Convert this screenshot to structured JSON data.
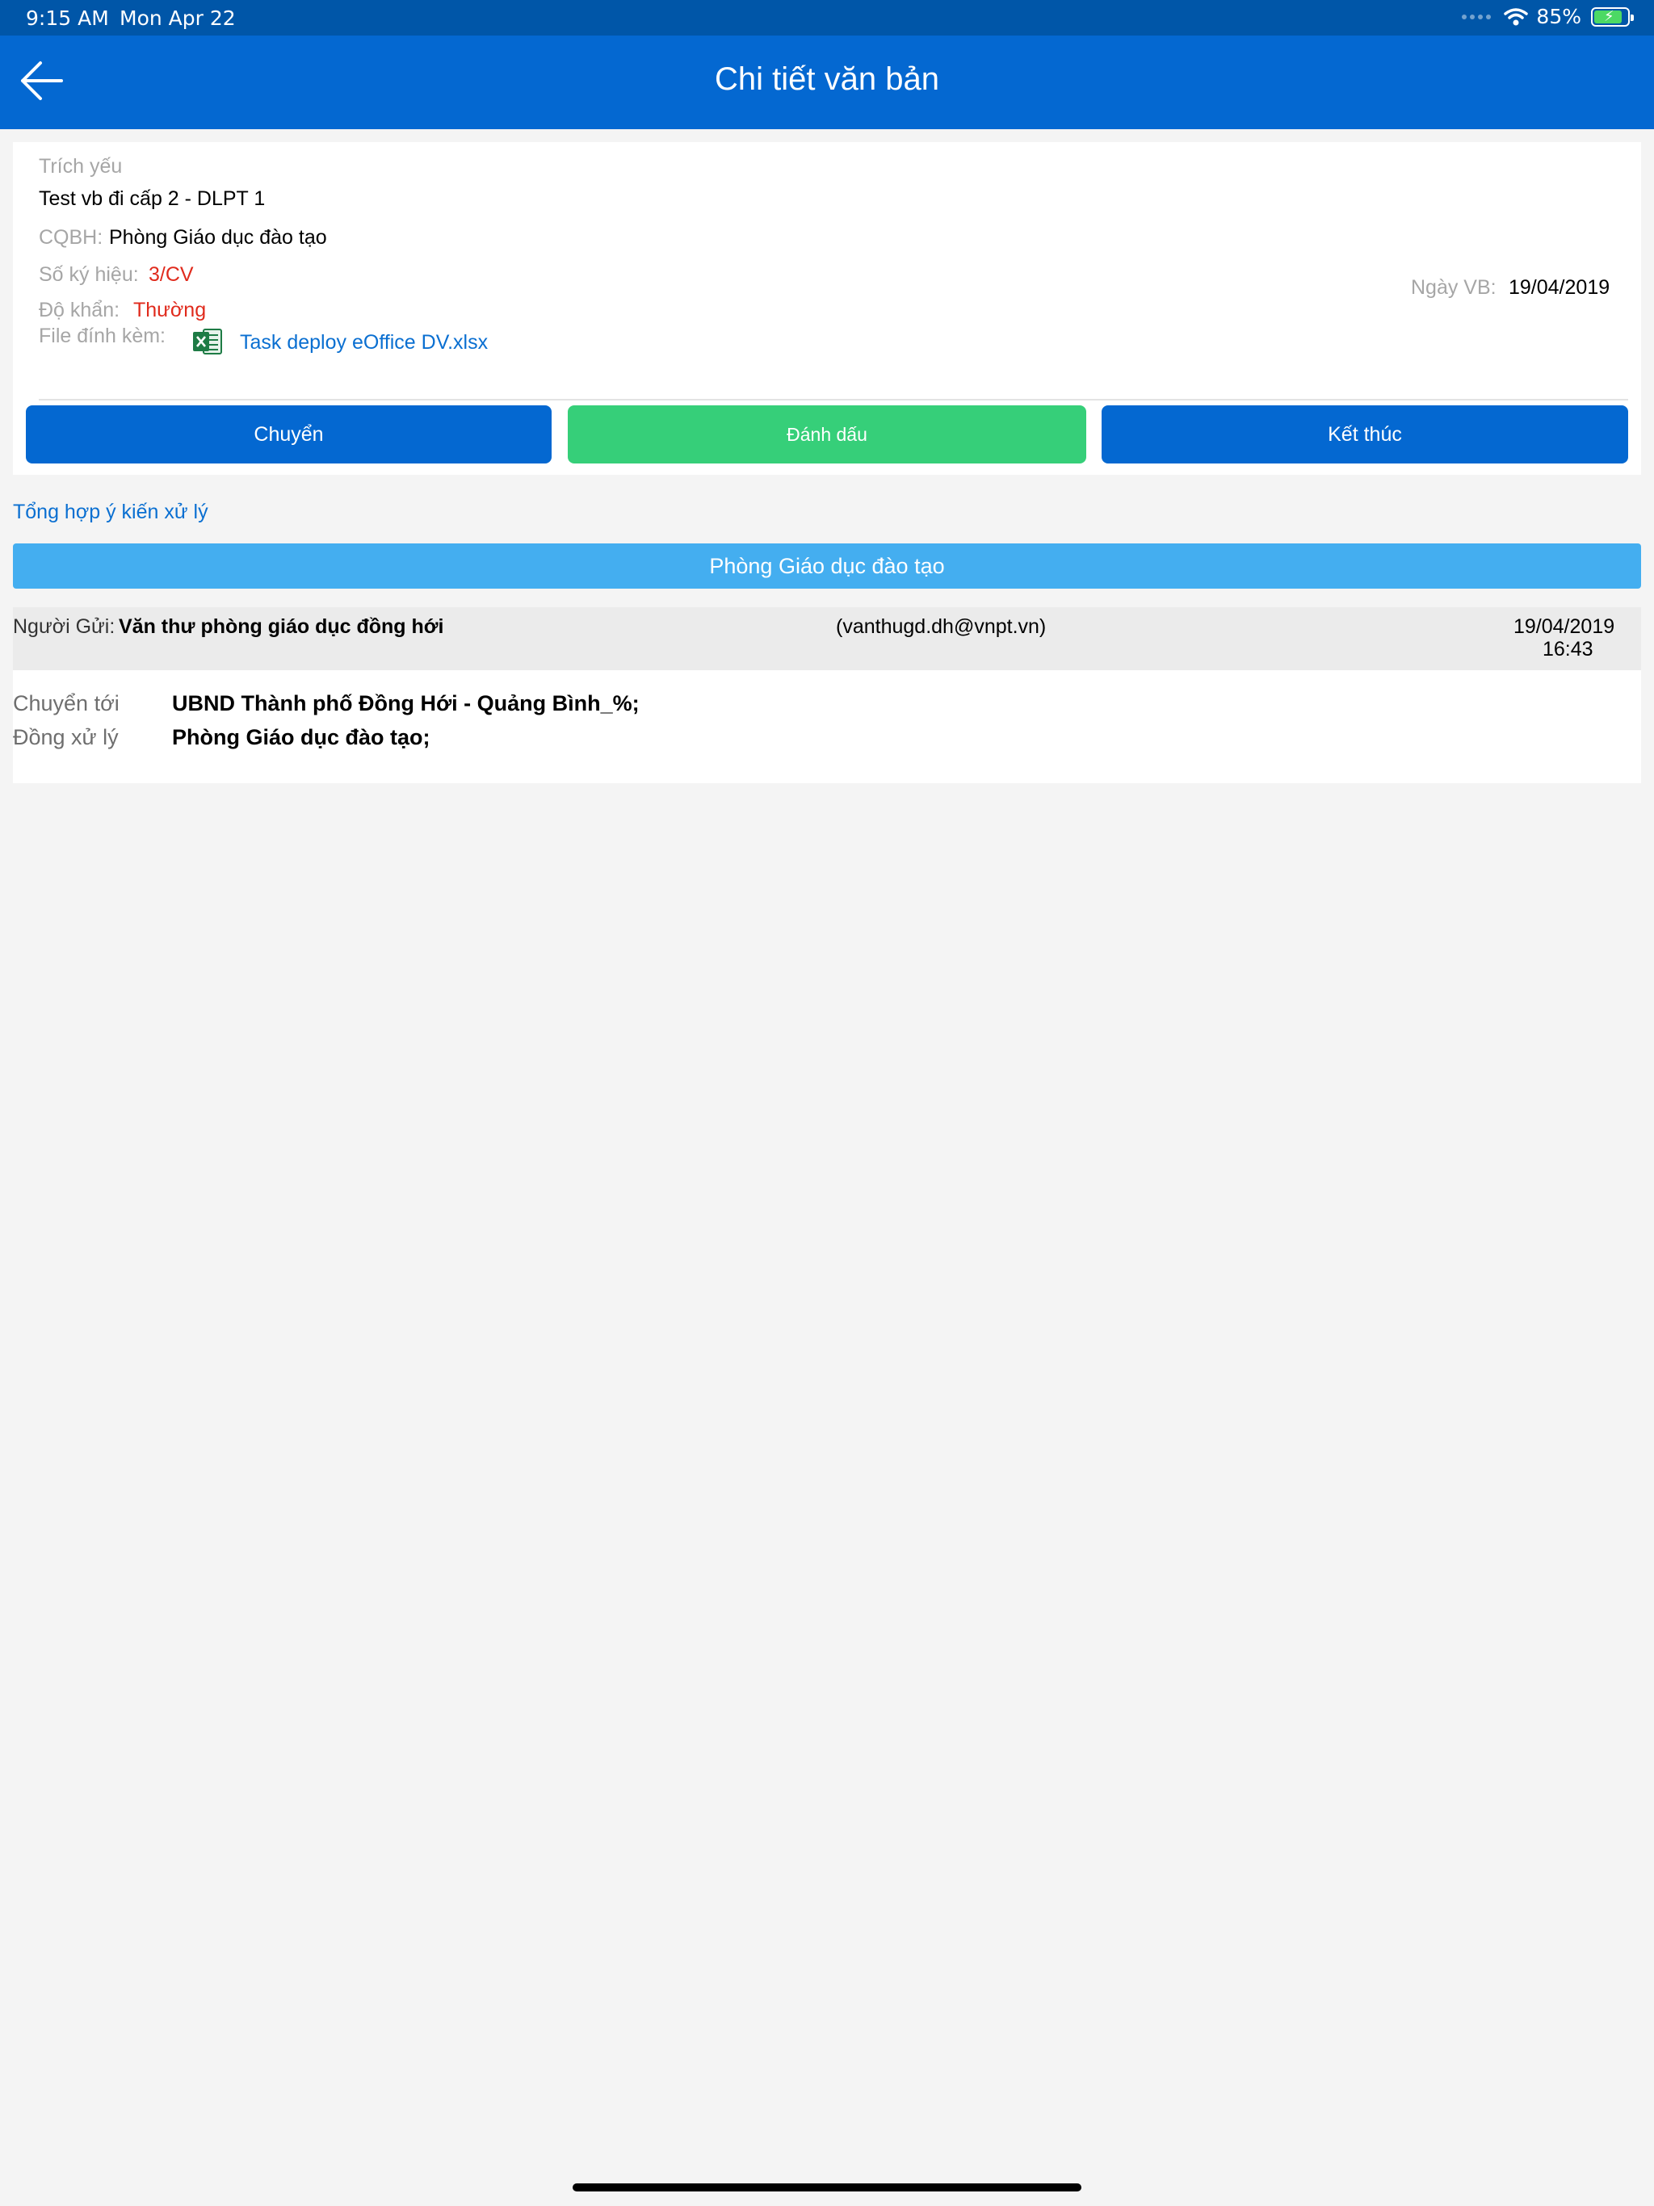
{
  "status_bar": {
    "time": "9:15 AM",
    "date": "Mon Apr 22",
    "battery": "85%",
    "icons": [
      "signal-dots-icon",
      "wifi-icon",
      "battery-charging-icon"
    ]
  },
  "nav": {
    "title": "Chi tiết văn bản",
    "back_icon": "arrow-left-icon"
  },
  "document": {
    "summary_label": "Trích yếu",
    "summary_value": "Test vb đi cấp 2 - DLPT 1",
    "issuer_label": "CQBH:",
    "issuer_value": "Phòng Giáo dục đào tạo",
    "number_label": "Số ký hiệu:",
    "number_value": "3/CV",
    "urgency_label": "Độ khẩn:",
    "urgency_value": "Thường",
    "attachment_label": "File đính kèm:",
    "attachment_name": "Task deploy eOffice DV.xlsx",
    "attachment_icon": "excel-file-icon",
    "date_label": "Ngày VB:",
    "date_value": "19/04/2019"
  },
  "actions": {
    "forward_label": "Chuyển",
    "mark_label": "Đánh dấu",
    "finish_label": "Kết thúc"
  },
  "opinions": {
    "summary_link": "Tổng hợp ý kiến xử lý",
    "section_title": "Phòng Giáo dục đào tạo",
    "sender_label": "Người Gửi:",
    "sender_name": "Văn thư phòng giáo dục đồng hới",
    "sender_email": "(vanthugd.dh@vnpt.vn)",
    "sent_date": "19/04/2019",
    "sent_time": "16:43",
    "forward_to_label": "Chuyển tới",
    "forward_to_value": "UBND Thành phố Đồng Hới - Quảng Bình_%;",
    "co_process_label": "Đồng xử lý",
    "co_process_value": "Phòng Giáo dục đào tạo;"
  },
  "colors": {
    "nav_blue": "#0468d1",
    "status_blue": "#0056a8",
    "green": "#36cf79",
    "light_blue": "#44aef0",
    "red": "#e02a1c",
    "link_blue": "#0a6fd1"
  }
}
